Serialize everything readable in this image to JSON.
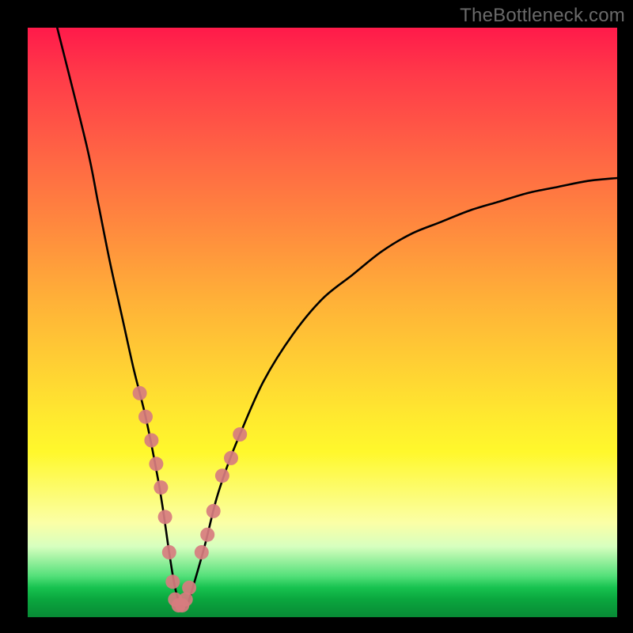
{
  "watermark": {
    "text": "TheBottleneck.com"
  },
  "chart_data": {
    "type": "line",
    "title": "",
    "xlabel": "",
    "ylabel": "",
    "xlim": [
      0,
      100
    ],
    "ylim": [
      0,
      100
    ],
    "series": [
      {
        "name": "curve",
        "x": [
          5,
          10,
          12,
          14,
          16,
          18,
          20,
          22,
          23,
          24,
          25,
          26,
          27,
          28,
          30,
          32,
          34,
          36,
          40,
          45,
          50,
          55,
          60,
          65,
          70,
          75,
          80,
          85,
          90,
          95,
          100
        ],
        "y": [
          100,
          80,
          70,
          60,
          51,
          42,
          34,
          24,
          18,
          11,
          5,
          2,
          2,
          5,
          12,
          20,
          26,
          31,
          40,
          48,
          54,
          58,
          62,
          65,
          67,
          69,
          70.5,
          72,
          73,
          74,
          74.5
        ]
      }
    ],
    "markers": {
      "name": "highlight-points",
      "color": "#d77c7f",
      "x": [
        19,
        20,
        21,
        21.8,
        22.6,
        23.3,
        24,
        24.6,
        25,
        25.6,
        26.2,
        26.8,
        27.4,
        29.5,
        30.5,
        31.5,
        33,
        34.5,
        36
      ],
      "y": [
        38,
        34,
        30,
        26,
        22,
        17,
        11,
        6,
        3,
        2,
        2,
        3,
        5,
        11,
        14,
        18,
        24,
        27,
        31
      ]
    },
    "gradient_stops": [
      {
        "pos": 0.0,
        "color": "#ff1a4a"
      },
      {
        "pos": 0.34,
        "color": "#ff8a3e"
      },
      {
        "pos": 0.66,
        "color": "#ffe92f"
      },
      {
        "pos": 0.88,
        "color": "#d7ffbf"
      },
      {
        "pos": 1.0,
        "color": "#088a35"
      }
    ]
  }
}
